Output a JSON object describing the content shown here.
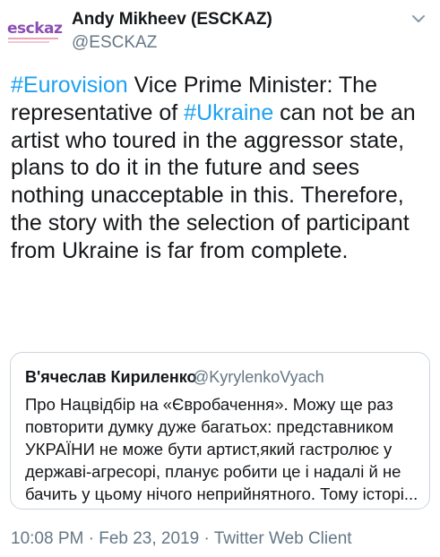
{
  "author": {
    "avatar_logo": "esckaz",
    "name": "Andy Mikheev (ESCKAZ)",
    "handle": "@ESCKAZ"
  },
  "tweet": {
    "hashtag1": "#Eurovision",
    "part1": " Vice Prime Minister: The representative of ",
    "hashtag2": "#Ukraine",
    "part2": " can not be an artist who toured in the aggressor state, plans to do it in the future and sees nothing unacceptable in this. Therefore, the story with the selection of participant from Ukraine is far from complete."
  },
  "quote": {
    "name": "В'ячеслав Кириленко",
    "handle": "@KyrylenkoVyach",
    "text": "Про Нацвідбір на «Євробачення». Можу ще раз повторити думку дуже багатьох: представником УКРАЇНИ не може бути артист,який гастролює у державі-агресорі, планує робити це і надалі й не бачить у цьому нічого неприйнятного. Тому історі..."
  },
  "meta": {
    "timestamp": "10:08 PM · Feb 23, 2019 · Twitter Web Client"
  },
  "icons": {
    "caret": "chevron-down-icon"
  },
  "colors": {
    "accent": "#1da1f2",
    "secondary_text": "#657786",
    "border": "#ccd6dd"
  }
}
